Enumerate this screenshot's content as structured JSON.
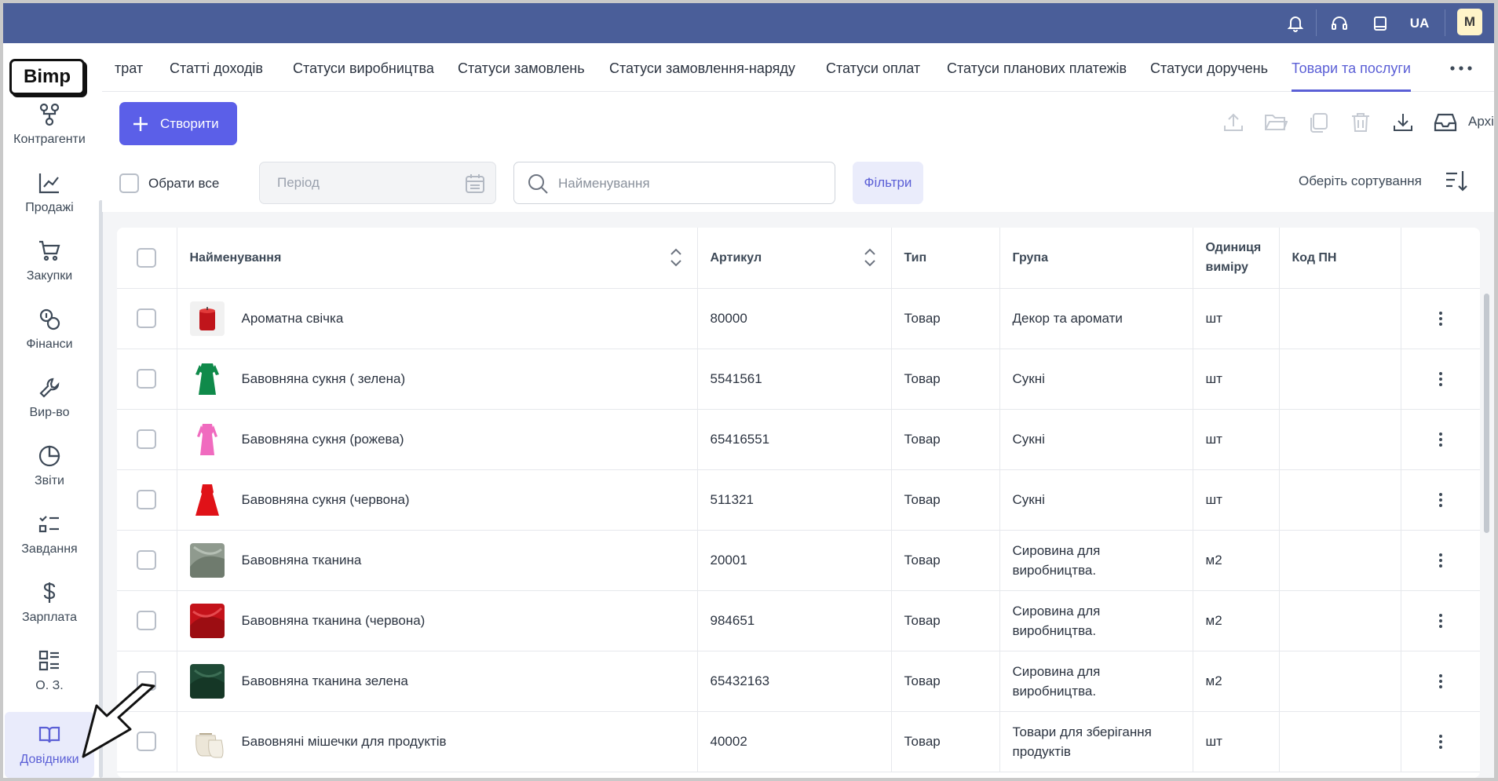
{
  "topbar": {
    "lang": "UA",
    "avatar": "M",
    "icons": [
      "bell-icon",
      "headset-icon",
      "book-icon"
    ]
  },
  "logo": "Bimp",
  "sidebar": {
    "items": [
      {
        "label": "Контрагенти",
        "icon": "contractors-icon"
      },
      {
        "label": "Продажі",
        "icon": "chart-line-icon"
      },
      {
        "label": "Закупки",
        "icon": "cart-icon"
      },
      {
        "label": "Фінанси",
        "icon": "coins-icon"
      },
      {
        "label": "Вир-во",
        "icon": "wrench-icon"
      },
      {
        "label": "Звіти",
        "icon": "pie-chart-icon"
      },
      {
        "label": "Завдання",
        "icon": "tasks-icon"
      },
      {
        "label": "Зарплата",
        "icon": "dollar-icon"
      },
      {
        "label": "О. З.",
        "icon": "list-icon"
      },
      {
        "label": "Довідники",
        "icon": "open-book-icon",
        "active": true
      }
    ]
  },
  "tabs": [
    {
      "label": "трат"
    },
    {
      "label": "Статті доходів"
    },
    {
      "label": "Статуси виробництва"
    },
    {
      "label": "Статуси замовлень"
    },
    {
      "label": "Статуси замовлення-наряду"
    },
    {
      "label": "Статуси оплат"
    },
    {
      "label": "Статуси планових платежів"
    },
    {
      "label": "Статуси доручень"
    },
    {
      "label": "Товари та послуги",
      "active": true
    }
  ],
  "toolbar": {
    "create_label": "Створити",
    "archive_label": "Архів",
    "select_all_label": "Обрати все",
    "period_placeholder": "Період",
    "search_placeholder": "Найменування",
    "filters_label": "Фільтри",
    "sort_label": "Оберіть сортування"
  },
  "table": {
    "headers": {
      "name": "Найменування",
      "sku": "Артикул",
      "type": "Тип",
      "group": "Група",
      "unit_line1": "Одиниця",
      "unit_line2": "виміру",
      "code": "Код ПН"
    },
    "rows": [
      {
        "name": "Ароматна свічка",
        "sku": "80000",
        "type": "Товар",
        "group": "Декор та аромати",
        "unit": "шт",
        "code": "",
        "thumb": "candle"
      },
      {
        "name": "Бавовняна сукня ( зелена)",
        "sku": "5541561",
        "type": "Товар",
        "group": "Сукні",
        "unit": "шт",
        "code": "",
        "thumb": "dress-green"
      },
      {
        "name": "Бавовняна сукня (рожева)",
        "sku": "65416551",
        "type": "Товар",
        "group": "Сукні",
        "unit": "шт",
        "code": "",
        "thumb": "dress-pink"
      },
      {
        "name": "Бавовняна сукня (червона)",
        "sku": "511321",
        "type": "Товар",
        "group": "Сукні",
        "unit": "шт",
        "code": "",
        "thumb": "dress-red"
      },
      {
        "name": "Бавовняна тканина",
        "sku": "20001",
        "type": "Товар",
        "group": "Сировина для виробництва.",
        "unit": "м2",
        "code": "",
        "thumb": "fabric-grey"
      },
      {
        "name": "Бавовняна тканина (червона)",
        "sku": "984651",
        "type": "Товар",
        "group": "Сировина для виробництва.",
        "unit": "м2",
        "code": "",
        "thumb": "fabric-red"
      },
      {
        "name": "Бавовняна тканина зелена",
        "sku": "65432163",
        "type": "Товар",
        "group": "Сировина для виробництва.",
        "unit": "м2",
        "code": "",
        "thumb": "fabric-green"
      },
      {
        "name": "Бавовняні мішечки для продуктів",
        "sku": "40002",
        "type": "Товар",
        "group": "Товари для зберігання продуктів",
        "unit": "шт",
        "code": "",
        "thumb": "bags"
      }
    ]
  },
  "colors": {
    "topbar": "#4a5e99",
    "accent": "#5b5fe8",
    "active_text": "#5b5fd6"
  }
}
